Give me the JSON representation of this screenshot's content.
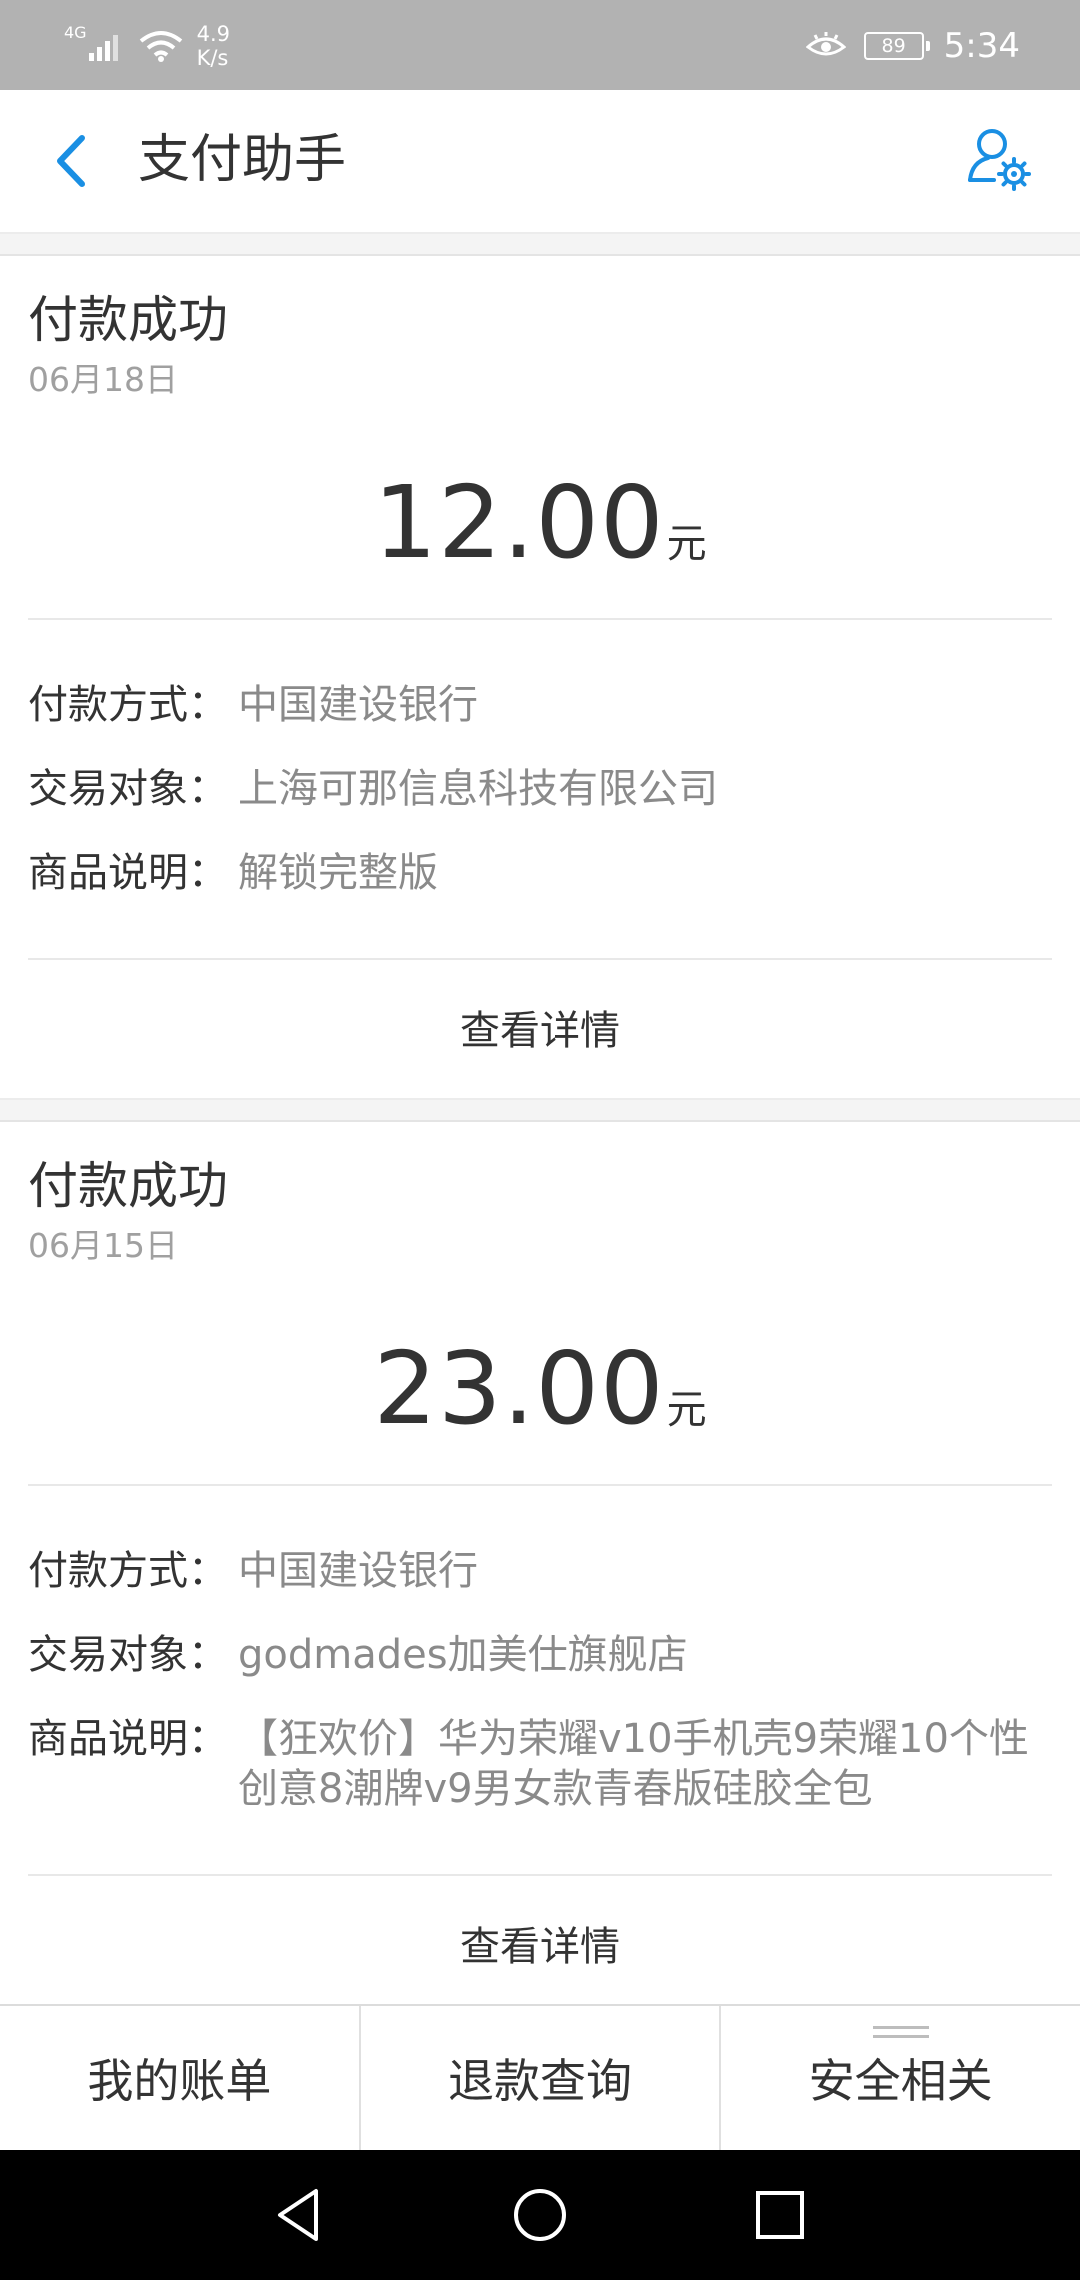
{
  "status_bar": {
    "network_type": "4G",
    "speed_value": "4.9",
    "speed_unit": "K/s",
    "battery": "89",
    "time": "5:34",
    "icons": [
      "signal-icon",
      "wifi-icon",
      "eye-icon",
      "battery-icon"
    ]
  },
  "header": {
    "title": "支付助手",
    "back_icon": "chevron-left-icon",
    "settings_icon": "user-settings-icon",
    "accent_color": "#1a8fe3"
  },
  "transactions": [
    {
      "status": "付款成功",
      "date": "06月18日",
      "amount": "12.00",
      "unit": "元",
      "fields": [
        {
          "label": "付款方式：",
          "value": "中国建设银行"
        },
        {
          "label": "交易对象：",
          "value": "上海可那信息科技有限公司"
        },
        {
          "label": "商品说明：",
          "value": "解锁完整版"
        }
      ],
      "detail_label": "查看详情"
    },
    {
      "status": "付款成功",
      "date": "06月15日",
      "amount": "23.00",
      "unit": "元",
      "fields": [
        {
          "label": "付款方式：",
          "value": "中国建设银行"
        },
        {
          "label": "交易对象：",
          "value": "godmades加美仕旗舰店"
        },
        {
          "label": "商品说明：",
          "value": "【狂欢价】华为荣耀v10手机壳9荣耀10个性创意8潮牌v9男女款青春版硅胶全包"
        }
      ],
      "detail_label": "查看详情"
    }
  ],
  "bottom_tabs": [
    {
      "label": "我的账单"
    },
    {
      "label": "退款查询"
    },
    {
      "label": "安全相关",
      "icon": "menu-icon"
    }
  ],
  "nav_bar": {
    "icons": [
      "back-triangle-icon",
      "home-circle-icon",
      "recents-square-icon"
    ]
  }
}
